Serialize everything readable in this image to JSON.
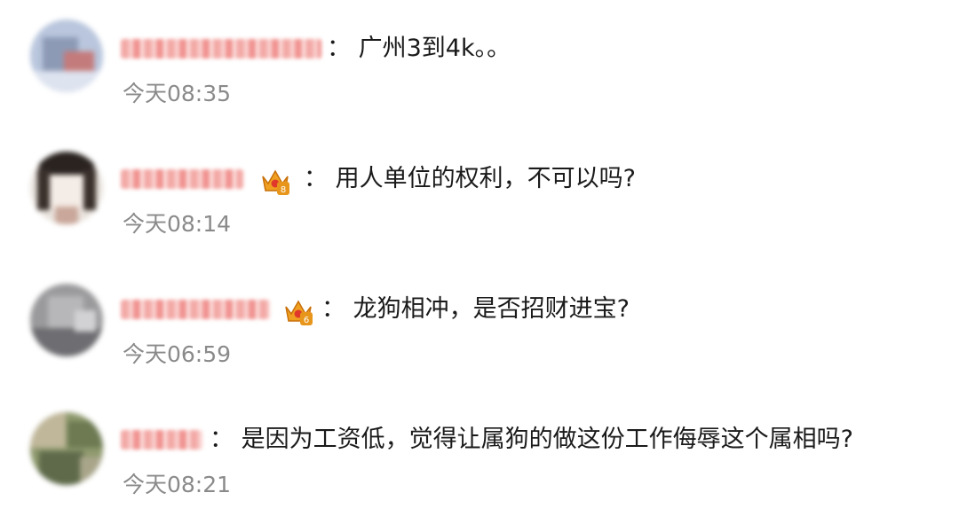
{
  "comments": [
    {
      "text": "： 广州3到4k。。",
      "time": "今天08:35",
      "badge": null
    },
    {
      "text": "： 用人单位的权利，不可以吗?",
      "time": "今天08:14",
      "badge": "8"
    },
    {
      "text": "： 龙狗相冲，是否招财进宝?",
      "time": "今天06:59",
      "badge": "6"
    },
    {
      "text": "： 是因为工资低，觉得让属狗的做这份工作侮辱这个属相吗?",
      "time": "今天08:21",
      "badge": null
    }
  ],
  "colors": {
    "time": "#8a8a8a",
    "text": "#1a1a1a",
    "name_blur": "#f3a9a6",
    "crown": "#f0a020"
  }
}
